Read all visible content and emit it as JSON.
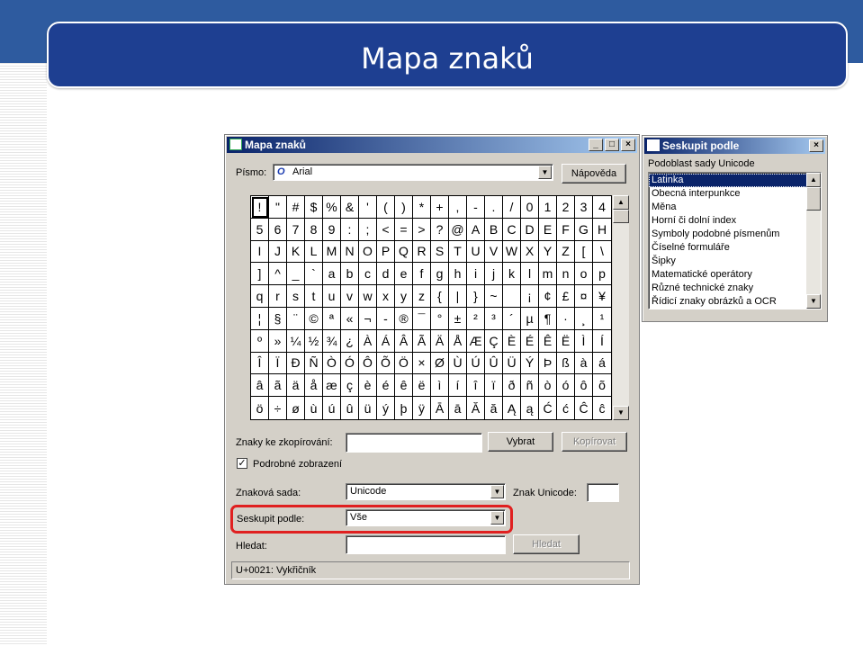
{
  "slide": {
    "title": "Mapa znaků"
  },
  "charmap": {
    "window_title": "Mapa znaků",
    "font_label": "Písmo:",
    "font_value": "Arial",
    "font_icon": "O",
    "help_button": "Nápověda",
    "characters": [
      [
        "!",
        "\"",
        "#",
        "$",
        "%",
        "&",
        "'",
        "(",
        ")",
        "*",
        "+",
        ",",
        "-",
        ".",
        "/",
        "0",
        "1",
        "2",
        "3",
        "4"
      ],
      [
        "5",
        "6",
        "7",
        "8",
        "9",
        ":",
        ";",
        "<",
        "=",
        ">",
        "?",
        "@",
        "A",
        "B",
        "C",
        "D",
        "E",
        "F",
        "G",
        "H"
      ],
      [
        "I",
        "J",
        "K",
        "L",
        "M",
        "N",
        "O",
        "P",
        "Q",
        "R",
        "S",
        "T",
        "U",
        "V",
        "W",
        "X",
        "Y",
        "Z",
        "[",
        "\\"
      ],
      [
        "]",
        "^",
        "_",
        "`",
        "a",
        "b",
        "c",
        "d",
        "e",
        "f",
        "g",
        "h",
        "i",
        "j",
        "k",
        "l",
        "m",
        "n",
        "o",
        "p"
      ],
      [
        "q",
        "r",
        "s",
        "t",
        "u",
        "v",
        "w",
        "x",
        "y",
        "z",
        "{",
        "|",
        "}",
        "~",
        " ",
        "¡",
        "¢",
        "£",
        "¤",
        "¥"
      ],
      [
        "¦",
        "§",
        "¨",
        "©",
        "ª",
        "«",
        "¬",
        "-",
        "®",
        "¯",
        "°",
        "±",
        "²",
        "³",
        "´",
        "µ",
        "¶",
        "·",
        "¸",
        "¹"
      ],
      [
        "º",
        "»",
        "¼",
        "½",
        "¾",
        "¿",
        "À",
        "Á",
        "Â",
        "Ã",
        "Ä",
        "Å",
        "Æ",
        "Ç",
        "È",
        "É",
        "Ê",
        "Ë",
        "Ì",
        "Í"
      ],
      [
        "Î",
        "Ï",
        "Ð",
        "Ñ",
        "Ò",
        "Ó",
        "Ô",
        "Õ",
        "Ö",
        "×",
        "Ø",
        "Ù",
        "Ú",
        "Û",
        "Ü",
        "Ý",
        "Þ",
        "ß",
        "à",
        "á"
      ],
      [
        "â",
        "ã",
        "ä",
        "å",
        "æ",
        "ç",
        "è",
        "é",
        "ê",
        "ë",
        "ì",
        "í",
        "î",
        "ï",
        "ð",
        "ñ",
        "ò",
        "ó",
        "ô",
        "õ"
      ],
      [
        "ö",
        "÷",
        "ø",
        "ù",
        "ú",
        "û",
        "ü",
        "ý",
        "þ",
        "ÿ",
        "Ā",
        "ā",
        "Ă",
        "ă",
        "Ą",
        "ą",
        "Ć",
        "ć",
        "Ĉ",
        "ĉ"
      ]
    ],
    "copy_label": "Znaky ke zkopírování:",
    "copy_value": "",
    "select_button": "Vybrat",
    "copy_button": "Kopírovat",
    "advanced_label": "Podrobné zobrazení",
    "advanced_checked": "✓",
    "charset_label": "Znaková sada:",
    "charset_value": "Unicode",
    "unicode_label": "Znak Unicode:",
    "unicode_value": "",
    "group_label": "Seskupit podle:",
    "group_value": "Vše",
    "search_label": "Hledat:",
    "search_value": "",
    "search_button": "Hledat",
    "status": "U+0021: Vykřičník"
  },
  "groupby": {
    "window_title": "Seskupit podle",
    "subrange_label": "Podoblast sady Unicode",
    "items": [
      "Latinka",
      "Obecná interpunkce",
      "Měna",
      "Horní či dolní index",
      "Symboly podobné písmenům",
      "Číselné formuláře",
      "Šipky",
      "Matematické operátory",
      "Různé technické znaky",
      "Řídicí znaky obrázků a OCR"
    ]
  }
}
